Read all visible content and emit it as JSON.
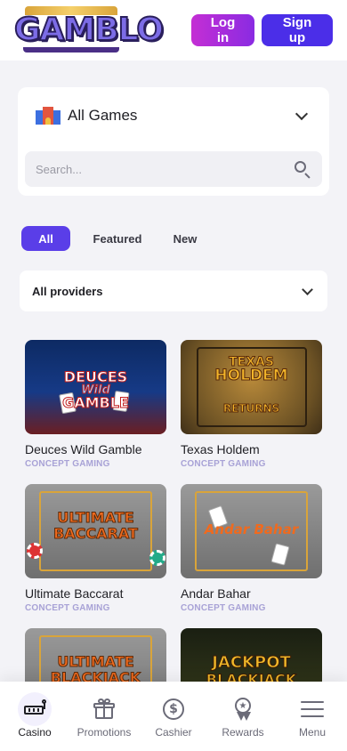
{
  "header": {
    "logo_text": "GAMBLO",
    "login_label": "Log in",
    "signup_label": "Sign up"
  },
  "category": {
    "label": "All Games",
    "icon": "castle-icon"
  },
  "search": {
    "placeholder": "Search..."
  },
  "tabs": [
    {
      "label": "All",
      "active": true
    },
    {
      "label": "Featured",
      "active": false
    },
    {
      "label": "New",
      "active": false
    }
  ],
  "providers": {
    "label": "All providers"
  },
  "games": [
    {
      "name": "Deuces Wild Gamble",
      "provider": "CONCEPT GAMING",
      "art_lines": [
        "DEUCES",
        "Wild",
        "GAMBLE"
      ]
    },
    {
      "name": "Texas Holdem",
      "provider": "CONCEPT GAMING",
      "art_lines": [
        "TEXAS",
        "HOLDEM",
        "RETURNS"
      ]
    },
    {
      "name": "Ultimate Baccarat",
      "provider": "CONCEPT GAMING",
      "art_lines": [
        "ULTIMATE",
        "BACCARAT"
      ]
    },
    {
      "name": "Andar Bahar",
      "provider": "CONCEPT GAMING",
      "art_lines": [
        "Andar Bahar"
      ]
    },
    {
      "name": "",
      "provider": "",
      "art_lines": [
        "ULTIMATE",
        "BLACKJACK"
      ]
    },
    {
      "name": "",
      "provider": "",
      "art_lines": [
        "JACKPOT",
        "BLACKJACK"
      ]
    }
  ],
  "bottom_nav": [
    {
      "label": "Casino",
      "icon": "slot-machine-icon",
      "active": true
    },
    {
      "label": "Promotions",
      "icon": "gift-icon",
      "active": false
    },
    {
      "label": "Cashier",
      "icon": "dollar-coin-icon",
      "active": false
    },
    {
      "label": "Rewards",
      "icon": "medal-icon",
      "active": false
    },
    {
      "label": "Menu",
      "icon": "hamburger-menu-icon",
      "active": false
    }
  ],
  "colors": {
    "accent": "#5a3ee8",
    "login_gradient_start": "#c42ed4",
    "signup": "#4b2ee8",
    "provider_text": "#a8a2d6"
  }
}
